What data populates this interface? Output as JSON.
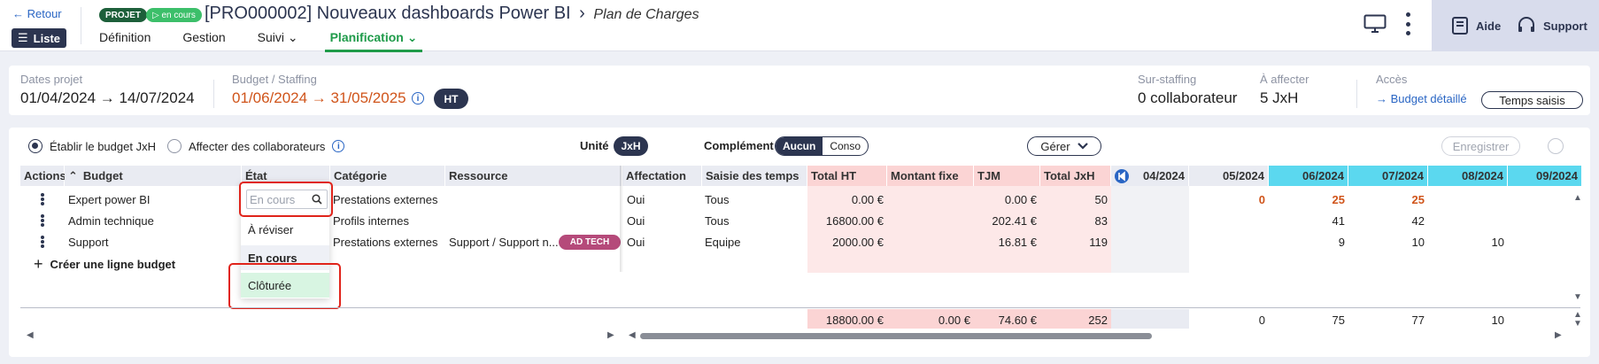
{
  "header": {
    "back": "← Retour",
    "list": "Liste",
    "badge_projet": "PROJET",
    "badge_status": "▷ en cours",
    "title": "[PRO000002] Nouveaux dashboards Power BI",
    "title_sep": "›",
    "subtitle": "Plan de Charges",
    "nav": [
      "Définition",
      "Gestion",
      "Suivi ⌄",
      "Planification ⌄"
    ],
    "help": "Aide",
    "support": "Support"
  },
  "info": {
    "dates_label": "Dates projet",
    "dates_value": "01/04/2024 → 14/07/2024",
    "budget_label": "Budget / Staffing",
    "budget_value": "01/06/2024 → 31/05/2025",
    "ht": "HT",
    "sur_label": "Sur-staffing",
    "sur_value": "0 collaborateur",
    "affecter_label": "À affecter",
    "affecter_value": "5 JxH",
    "acces_label": "Accès",
    "budget_detail": "→ Budget détaillé",
    "temps": "Temps saisis"
  },
  "toolbar": {
    "radio1": "Établir le budget JxH",
    "radio2": "Affecter des collaborateurs",
    "unite": "Unité",
    "jxh": "JxH",
    "complement": "Complément",
    "aucun": "Aucun",
    "conso": "Conso",
    "gerer": "Gérer",
    "enregistrer": "Enregistrer"
  },
  "table": {
    "headers": {
      "actions": "Actions",
      "budget": "Budget",
      "etat": "État",
      "categorie": "Catégorie",
      "ressource": "Ressource",
      "affectation": "Affectation",
      "saisie": "Saisie des temps",
      "total_ht": "Total HT",
      "montant": "Montant fixe",
      "tjm": "TJM",
      "total_jxh": "Total JxH",
      "m0424": "04/2024",
      "m0524": "05/2024",
      "m0624": "06/2024",
      "m0724": "07/2024",
      "m0824": "08/2024",
      "m0924": "09/2024"
    },
    "rows": [
      {
        "budget": "Expert power BI",
        "categorie": "Prestations externes",
        "ressource": "",
        "affectation": "Oui",
        "saisie": "Tous",
        "total_ht": "0.00 €",
        "tjm": "0.00 €",
        "jxh": "50",
        "m05": "0",
        "m06": "25",
        "m07": "25",
        "m08": ""
      },
      {
        "budget": "Admin technique",
        "categorie": "Profils internes",
        "ressource": "",
        "affectation": "Oui",
        "saisie": "Tous",
        "total_ht": "16800.00 €",
        "tjm": "202.41 €",
        "jxh": "83",
        "m05": "",
        "m06": "41",
        "m07": "42",
        "m08": ""
      },
      {
        "budget": "Support",
        "categorie": "Prestations externes",
        "ressource": "Support / Support n...",
        "tag": "AD TECH",
        "affectation": "Oui",
        "saisie": "Equipe",
        "total_ht": "2000.00 €",
        "tjm": "16.81 €",
        "jxh": "119",
        "m05": "",
        "m06": "9",
        "m07": "10",
        "m08": "10"
      }
    ],
    "create": "Créer une ligne budget",
    "totals": {
      "total_ht": "18800.00 €",
      "montant": "0.00 €",
      "tjm": "74.60 €",
      "jxh": "252",
      "m05": "0",
      "m06": "75",
      "m07": "77",
      "m08": "10"
    }
  },
  "dropdown": {
    "placeholder": "En cours",
    "options": [
      "À réviser",
      "En cours",
      "Clôturée"
    ]
  }
}
